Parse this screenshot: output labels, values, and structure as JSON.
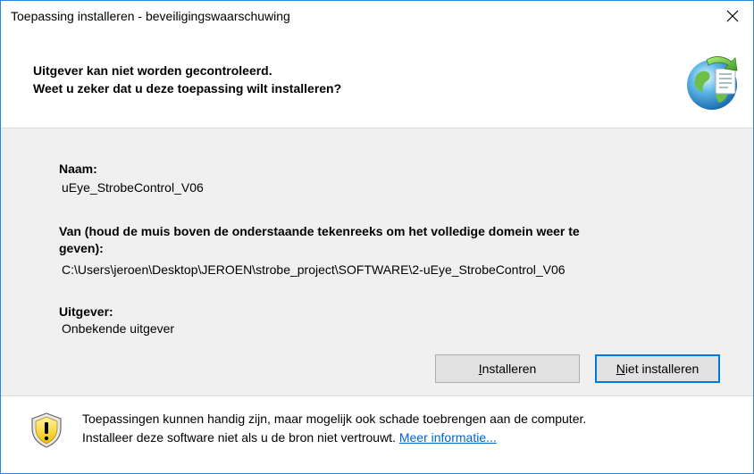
{
  "window": {
    "title": "Toepassing installeren - beveiligingswaarschuwing",
    "close_symbol": "✕"
  },
  "header": {
    "line1": "Uitgever kan niet worden gecontroleerd.",
    "line2": "Weet u zeker dat u deze toepassing wilt installeren?",
    "icon": "application-install-globe-icon"
  },
  "details": {
    "name_label": "Naam:",
    "name_value": "uEye_StrobeControl_V06",
    "from_label_line1": "Van (houd de muis boven de onderstaande tekenreeks om het volledige domein weer te",
    "from_label_line2": "geven):",
    "from_value": "C:\\Users\\jeroen\\Desktop\\JEROEN\\strobe_project\\SOFTWARE\\2-uEye_StrobeControl_V06",
    "publisher_label": "Uitgever:",
    "publisher_value": "Onbekende uitgever"
  },
  "buttons": {
    "install_prefix": "",
    "install_accel": "I",
    "install_rest": "nstalleren",
    "dont_install_prefix": "",
    "dont_install_accel": "N",
    "dont_install_rest": "iet installeren"
  },
  "footer": {
    "line1": "Toepassingen kunnen handig zijn, maar mogelijk ook schade toebrengen aan de computer.",
    "line2": "Installeer deze software niet als u de bron niet vertrouwt.",
    "link": "Meer informatie...",
    "icon": "warning-shield-icon"
  },
  "colors": {
    "accent": "#0078d7",
    "link": "#0066cc",
    "panel": "#f0f0f0",
    "window_border": "#2b88d8"
  }
}
